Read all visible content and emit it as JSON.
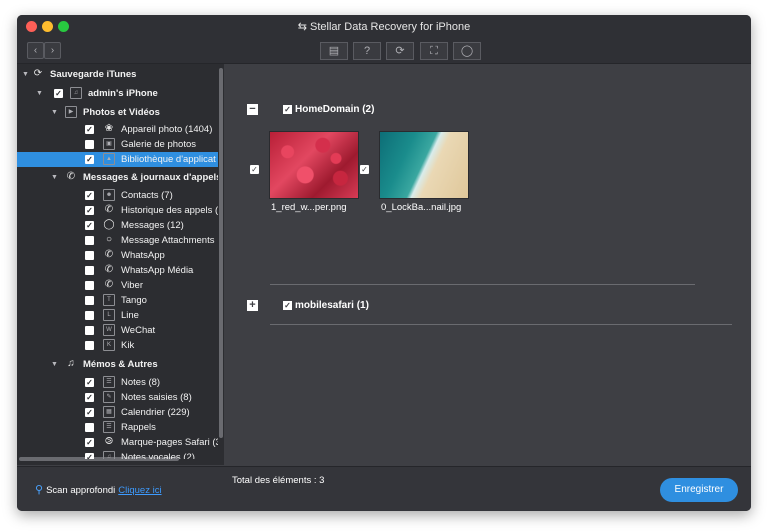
{
  "window": {
    "title": "Stellar Data Recovery for iPhone"
  },
  "toolbar": {
    "nav": [
      "back-icon",
      "forward-icon"
    ],
    "buttons": [
      "document-icon",
      "help-icon",
      "refresh-icon",
      "cart-icon",
      "account-icon"
    ],
    "help_glyph": "?"
  },
  "sidebar": {
    "root": "Sauvegarde iTunes",
    "device": "admin's iPhone",
    "photos_group": "Photos et Vidéos",
    "photos_items": [
      {
        "label": "Appareil photo (1404)",
        "checked": true
      },
      {
        "label": "Galerie de photos",
        "checked": false
      },
      {
        "label": "Bibliothèque d'applicat",
        "checked": true,
        "selected": true
      }
    ],
    "messages_group": "Messages & journaux d'appels",
    "messages_items": [
      {
        "label": "Contacts (7)",
        "checked": true
      },
      {
        "label": "Historique des appels (",
        "checked": true
      },
      {
        "label": "Messages (12)",
        "checked": true
      },
      {
        "label": "Message Attachments",
        "checked": false
      },
      {
        "label": "WhatsApp",
        "checked": false
      },
      {
        "label": "WhatsApp Média",
        "checked": false
      },
      {
        "label": "Viber",
        "checked": false
      },
      {
        "label": "Tango",
        "checked": false
      },
      {
        "label": "Line",
        "checked": false
      },
      {
        "label": "WeChat",
        "checked": false
      },
      {
        "label": "Kik",
        "checked": false
      }
    ],
    "memos_group": "Mémos & Autres",
    "memos_items": [
      {
        "label": "Notes (8)",
        "checked": true
      },
      {
        "label": "Notes saisies (8)",
        "checked": true
      },
      {
        "label": "Calendrier (229)",
        "checked": true
      },
      {
        "label": "Rappels",
        "checked": false
      },
      {
        "label": "Marque-pages Safari (3",
        "checked": true
      },
      {
        "label": "Notes vocales (2)",
        "checked": true
      }
    ]
  },
  "main": {
    "groups": [
      {
        "label": "HomeDomain (2)",
        "expanded": true,
        "checked": true
      },
      {
        "label": "mobilesafari (1)",
        "expanded": false,
        "checked": true
      }
    ],
    "files": [
      {
        "name": "1_red_w...per.png",
        "checked": true
      },
      {
        "name": "0_LockBa...nail.jpg",
        "checked": true
      }
    ],
    "collapse_glyph": "−",
    "expand_glyph": "+"
  },
  "footer": {
    "scan_label": "Scan approfondi",
    "scan_link": "Cliquez ici",
    "total_label": "Total des éléments :",
    "total_count": "3",
    "save_label": "Enregistrer"
  },
  "colors": {
    "accent": "#2f8fe0",
    "link": "#3d9bff",
    "sidebar_bg": "#2c2d31",
    "main_bg": "#3e3f44"
  }
}
